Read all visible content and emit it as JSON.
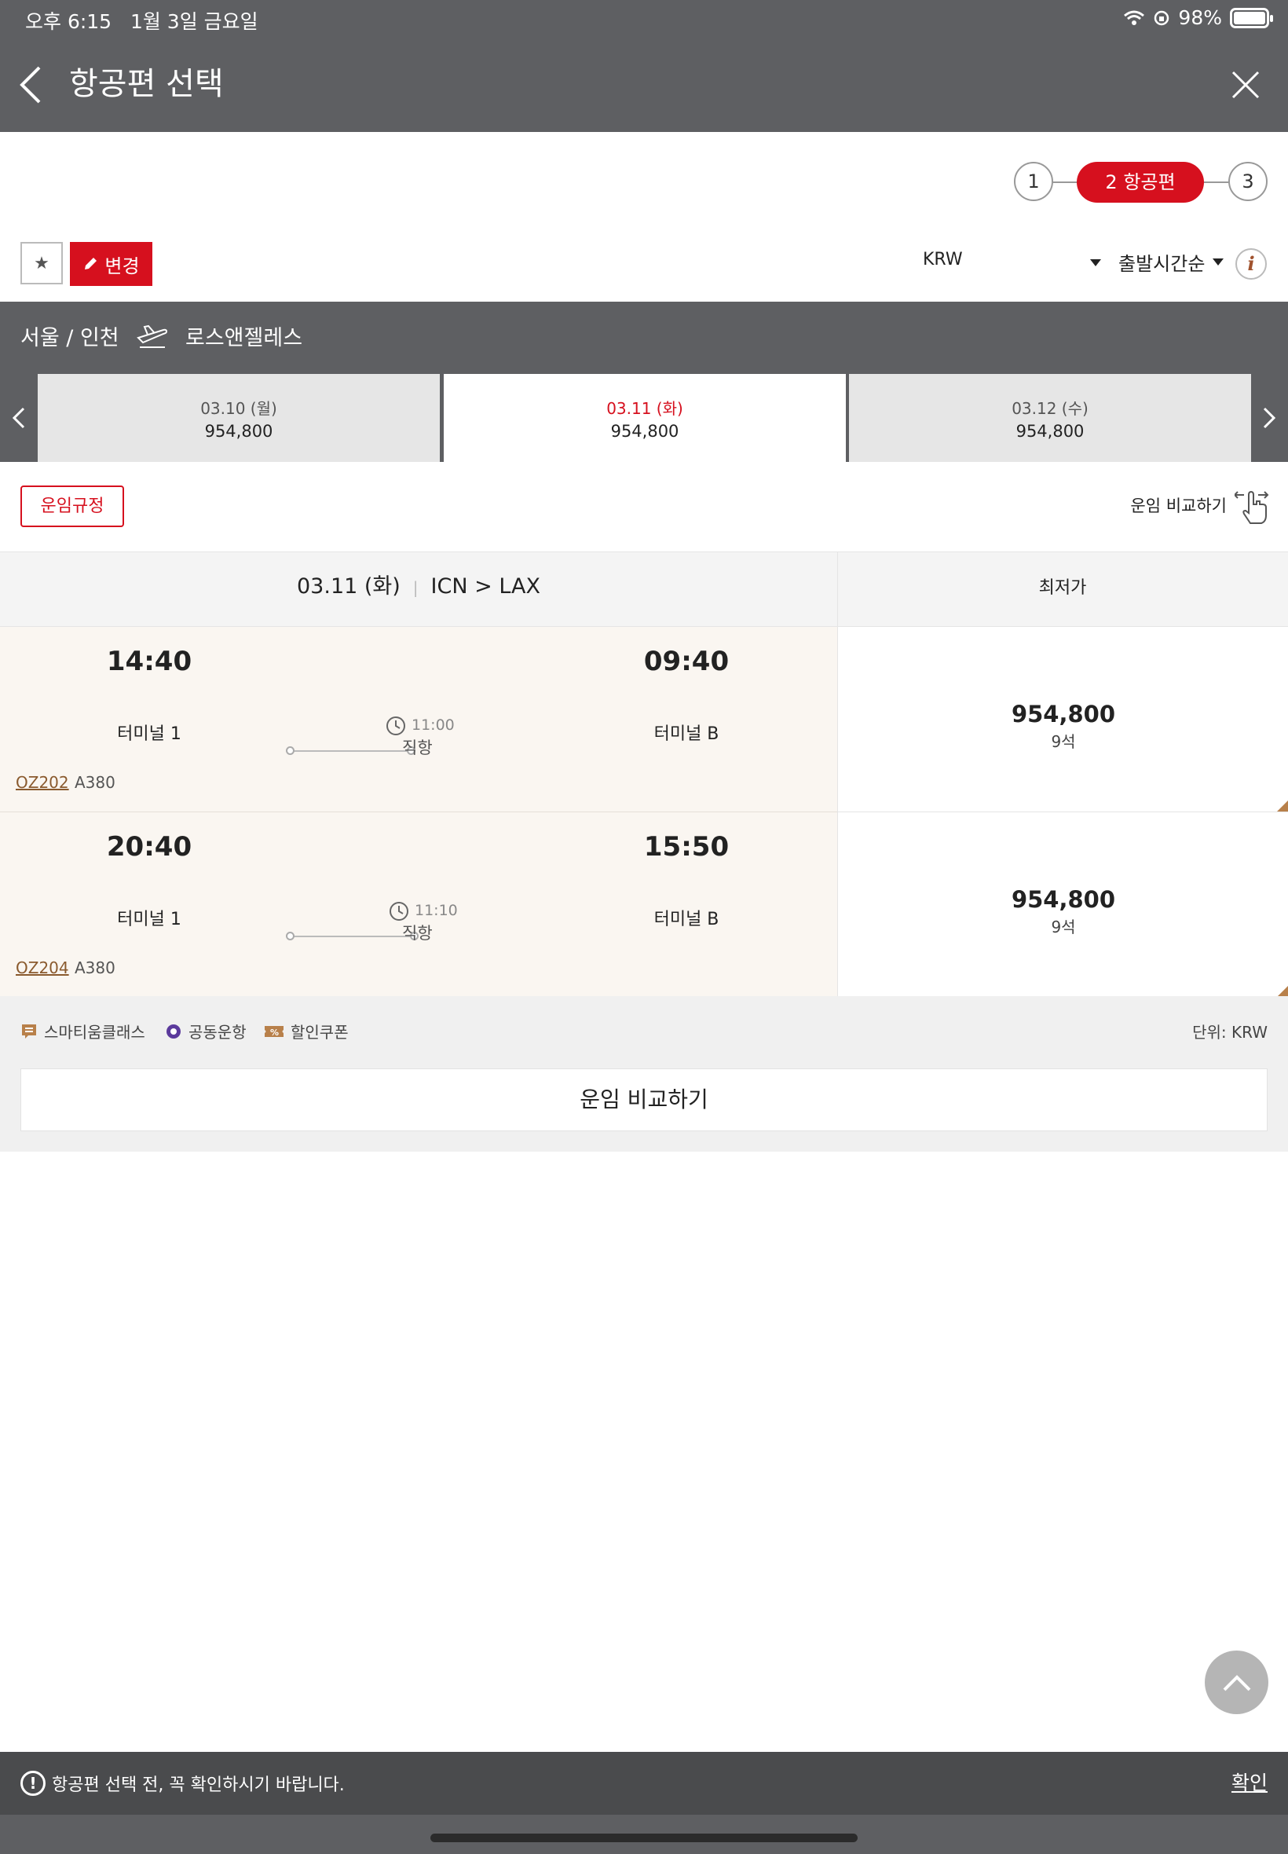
{
  "status_bar": {
    "time": "오후 6:15",
    "date": "1월 3일 금요일",
    "battery": "98%"
  },
  "header": {
    "title": "항공편 선택"
  },
  "steps": {
    "step1": "1",
    "step2": "2  항공편",
    "step3": "3"
  },
  "controls": {
    "edit_label": "변경",
    "currency": "KRW",
    "sort": "출발시간순",
    "info": "i"
  },
  "route": {
    "origin": "서울 / 인천",
    "destination": "로스앤젤레스"
  },
  "date_tabs": [
    {
      "date": "03.10 (월)",
      "price": "954,800"
    },
    {
      "date": "03.11 (화)",
      "price": "954,800"
    },
    {
      "date": "03.12 (수)",
      "price": "954,800"
    }
  ],
  "fare_rules_label": "운임규정",
  "compare_top_label": "운임 비교하기",
  "table_header": {
    "date": "03.11 (화)",
    "route": "ICN  >  LAX",
    "lowest": "최저가"
  },
  "flights": [
    {
      "dep_time": "14:40",
      "arr_time": "09:40",
      "dep_terminal": "터미널 1",
      "arr_terminal": "터미널 B",
      "duration": "11:00",
      "type": "직항",
      "flight_no": "OZ202",
      "aircraft": "A380",
      "price": "954,800",
      "seats": "9석"
    },
    {
      "dep_time": "20:40",
      "arr_time": "15:50",
      "dep_terminal": "터미널 1",
      "arr_terminal": "터미널 B",
      "duration": "11:10",
      "type": "직항",
      "flight_no": "OZ204",
      "aircraft": "A380",
      "price": "954,800",
      "seats": "9석"
    }
  ],
  "legend": {
    "smartium": "스마티움클래스",
    "codeshare": "공동운항",
    "coupon": "할인쿠폰",
    "unit": "단위: KRW"
  },
  "compare_button_label": "운임 비교하기",
  "notice": {
    "text": "항공편 선택 전, 꼭 확인하시기 바랍니다.",
    "confirm": "확인"
  },
  "colors": {
    "accent": "#d6101e",
    "header_bg": "#5e5f62",
    "row_bg": "#faf6f1",
    "brown": "#8a5a2e"
  }
}
